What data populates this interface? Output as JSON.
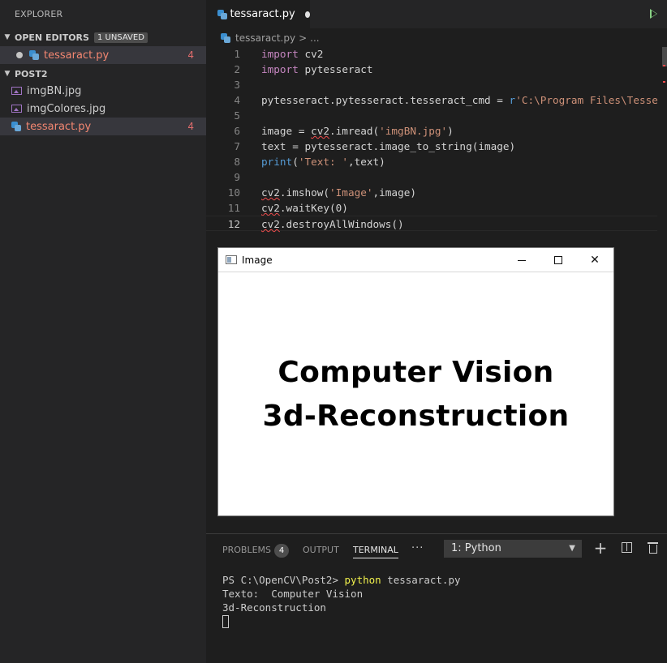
{
  "sidebar": {
    "title": "EXPLORER",
    "open_editors": {
      "label": "OPEN EDITORS",
      "badge": "1 UNSAVED",
      "items": [
        {
          "name": "tessaract.py",
          "count": "4"
        }
      ]
    },
    "folder": {
      "label": "POST2",
      "items": [
        {
          "name": "imgBN.jpg",
          "count": ""
        },
        {
          "name": "imgColores.jpg",
          "count": ""
        },
        {
          "name": "tessaract.py",
          "count": "4"
        }
      ]
    }
  },
  "editor": {
    "tab_label": "tessaract.py",
    "breadcrumb": {
      "file": "tessaract.py",
      "more": "..."
    },
    "lines": [
      {
        "n": "1"
      },
      {
        "n": "2"
      },
      {
        "n": "3"
      },
      {
        "n": "4"
      },
      {
        "n": "5"
      },
      {
        "n": "6"
      },
      {
        "n": "7"
      },
      {
        "n": "8"
      },
      {
        "n": "9"
      },
      {
        "n": "10"
      },
      {
        "n": "11"
      },
      {
        "n": "12"
      }
    ],
    "code": {
      "l1_kw": "import",
      "l1_rest": " cv2",
      "l2_kw": "import",
      "l2_rest": " pytesseract",
      "l4_a": "pytesseract.pytesseract.tesseract_cmd = ",
      "l4_r": "r",
      "l4_str": "'C:\\Program Files\\Tesse",
      "l6_a": "image = ",
      "l6_cv": "cv2",
      "l6_b": ".imread(",
      "l6_str": "'imgBN.jpg'",
      "l6_c": ")",
      "l7": "text = pytesseract.image_to_string(image)",
      "l8_fn": "print",
      "l8_a": "(",
      "l8_str": "'Text: '",
      "l8_b": ",text)",
      "l10_cv": "cv2",
      "l10_a": ".imshow(",
      "l10_str": "'Image'",
      "l10_b": ",image)",
      "l11_cv": "cv2",
      "l11_a": ".waitKey(0)",
      "l12_cv": "cv2",
      "l12_a": ".destroyAllWindows()"
    }
  },
  "image_window": {
    "title": "Image",
    "close_glyph": "✕",
    "line1": "Computer Vision",
    "line2": "3d-Reconstruction"
  },
  "panel": {
    "tabs": {
      "problems": "PROBLEMS",
      "problems_count": "4",
      "output": "OUTPUT",
      "terminal": "TERMINAL"
    },
    "more": "···",
    "terminal_select": "1: Python",
    "add_glyph": "+",
    "terminal": {
      "prompt": "PS C:\\OpenCV\\Post2> ",
      "cmd": "python",
      "args": " tessaract.py",
      "out1": "Texto:  Computer Vision",
      "out2": "3d-Reconstruction"
    }
  }
}
